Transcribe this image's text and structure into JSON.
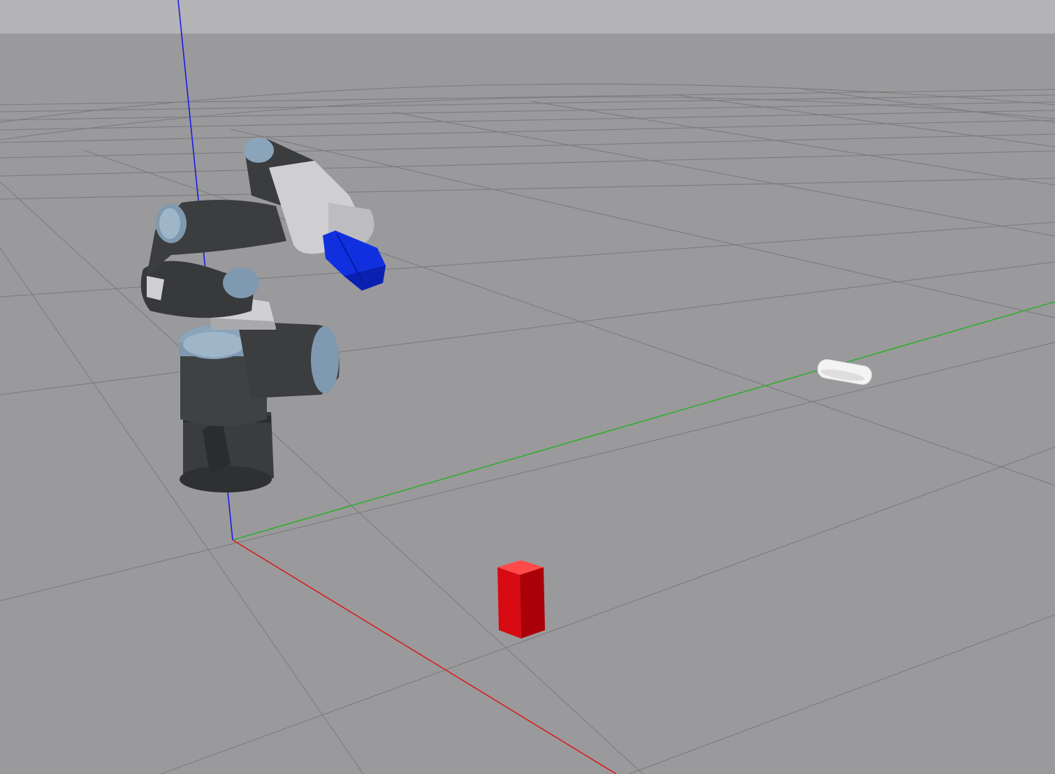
{
  "scene": {
    "view": "3d-simulation-viewport",
    "colors": {
      "sky": "#b4b3b5",
      "ground": "#9a999b",
      "grid_line": "#7c7b7d",
      "axis_x": "#e01010",
      "axis_y": "#22b022",
      "axis_z": "#1a1ae8",
      "robot_dark": "#3a3c3e",
      "robot_joint_cap": "#7f99b0",
      "robot_silver": "#cfcfd1",
      "gripper": "#1030e0",
      "red_block": "#d80a12",
      "white_object": "#f4f4f4"
    },
    "objects": [
      {
        "name": "ur-robot-arm",
        "type": "robot-manipulator"
      },
      {
        "name": "gripper",
        "type": "end-effector"
      },
      {
        "name": "red-block",
        "type": "box"
      },
      {
        "name": "white-object",
        "type": "capsule"
      }
    ]
  }
}
